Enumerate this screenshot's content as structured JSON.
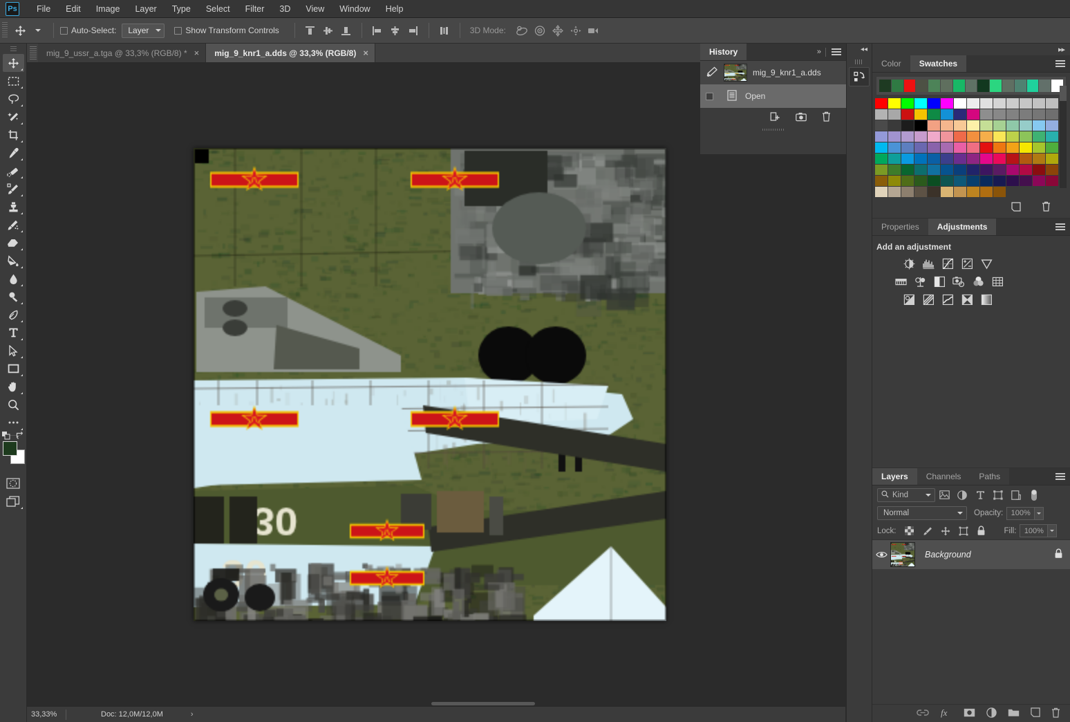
{
  "app": {
    "name": "Adobe Photoshop",
    "logo_text": "Ps"
  },
  "menubar": {
    "items": [
      {
        "label": "File"
      },
      {
        "label": "Edit"
      },
      {
        "label": "Image"
      },
      {
        "label": "Layer"
      },
      {
        "label": "Type"
      },
      {
        "label": "Select"
      },
      {
        "label": "Filter"
      },
      {
        "label": "3D"
      },
      {
        "label": "View"
      },
      {
        "label": "Window"
      },
      {
        "label": "Help"
      }
    ]
  },
  "options_bar": {
    "tool_icon": "move-tool-icon",
    "auto_select_label": "Auto-Select:",
    "auto_select_checked": false,
    "layer_dropdown_value": "Layer",
    "show_transform_label": "Show Transform Controls",
    "show_transform_checked": false,
    "align_icons": [
      "align-top-edges-icon",
      "align-vertical-centers-icon",
      "align-bottom-edges-icon",
      "align-left-edges-icon",
      "align-horizontal-centers-icon",
      "align-right-edges-icon",
      "distribute-icon"
    ],
    "mode_3d_label": "3D Mode:",
    "mode_3d_icons": [
      "orbit-3d-icon",
      "roll-3d-icon",
      "pan-3d-icon",
      "slide-3d-icon",
      "zoom-3d-camera-icon"
    ]
  },
  "toolbar": {
    "tools": [
      {
        "name": "move-tool",
        "icon": "move-tool-icon",
        "active": true
      },
      {
        "name": "rectangular-marquee-tool",
        "icon": "marquee-icon",
        "active": false
      },
      {
        "name": "lasso-tool",
        "icon": "lasso-icon",
        "active": false
      },
      {
        "name": "magic-wand-tool",
        "icon": "magic-wand-icon",
        "active": false
      },
      {
        "name": "crop-tool",
        "icon": "crop-icon",
        "active": false
      },
      {
        "name": "eyedropper-tool",
        "icon": "eyedropper-icon",
        "active": false
      },
      {
        "name": "spot-healing-brush-tool",
        "icon": "healing-brush-icon",
        "active": false
      },
      {
        "name": "brush-tool",
        "icon": "brush-icon",
        "active": false
      },
      {
        "name": "clone-stamp-tool",
        "icon": "clone-stamp-icon",
        "active": false
      },
      {
        "name": "history-brush-tool",
        "icon": "history-brush-icon",
        "active": false
      },
      {
        "name": "eraser-tool",
        "icon": "eraser-icon",
        "active": false
      },
      {
        "name": "gradient-tool",
        "icon": "paint-bucket-icon",
        "active": false
      },
      {
        "name": "blur-tool",
        "icon": "blur-drop-icon",
        "active": false
      },
      {
        "name": "dodge-tool",
        "icon": "dodge-icon",
        "active": false
      },
      {
        "name": "pen-tool",
        "icon": "pen-icon",
        "active": false
      },
      {
        "name": "type-tool",
        "icon": "type-icon",
        "active": false
      },
      {
        "name": "path-selection-tool",
        "icon": "path-selection-arrow-icon",
        "active": false
      },
      {
        "name": "rectangle-tool",
        "icon": "rectangle-shape-icon",
        "active": false
      },
      {
        "name": "hand-tool",
        "icon": "hand-icon",
        "active": false
      },
      {
        "name": "zoom-tool",
        "icon": "zoom-magnifier-icon",
        "active": false
      },
      {
        "name": "edit-toolbar",
        "icon": "ellipsis-icon",
        "active": false
      }
    ],
    "foreground_color": "#1d3a1d",
    "background_color": "#ffffff",
    "quick_mask_icon": "quick-mask-icon",
    "screen_mode_icon": "screen-mode-icon"
  },
  "document_tabs": [
    {
      "label": "mig_9_ussr_a.tga @ 33,3% (RGB/8) *",
      "active": false,
      "close": "×"
    },
    {
      "label": "mig_9_knr1_a.dds @ 33,3% (RGB/8)",
      "active": true,
      "close": "×"
    }
  ],
  "canvas": {
    "document_name": "mig_9_knr1_a.dds",
    "zoom": "33,3%",
    "markings_text": "30",
    "insignia": "chinese-red-star-roundel"
  },
  "status_bar": {
    "zoom": "33,33%",
    "doc_info": "Doc: 12,0M/12,0M",
    "expand_arrow": "›"
  },
  "collapsed_dock": {
    "collapse_icon": "◂◂",
    "button_icon": "history-panel-icon"
  },
  "history_panel": {
    "tab_label": "History",
    "expand_icon": "»",
    "menu_icon": "panel-menu-icon",
    "snapshot": {
      "label": "mig_9_knr1_a.dds",
      "icon": "history-source-icon"
    },
    "states": [
      {
        "label": "Open",
        "icon": "open-document-icon",
        "selected": true
      }
    ],
    "footer_buttons": [
      {
        "name": "create-document-from-state-button",
        "icon": "new-doc-icon"
      },
      {
        "name": "create-new-snapshot-button",
        "icon": "camera-icon"
      },
      {
        "name": "delete-state-button",
        "icon": "trash-icon"
      }
    ]
  },
  "color_swatches_panel": {
    "tabs": [
      {
        "label": "Color",
        "active": false
      },
      {
        "label": "Swatches",
        "active": true
      }
    ],
    "menu_icon": "panel-menu-icon",
    "recent_colors": [
      "#1e3a22",
      "#2f7a43",
      "#ee1111",
      "#4d5144",
      "#4d8358",
      "#5f6f5e",
      "#18b866",
      "#5f7265",
      "#12381f",
      "#2bd680",
      "#5f6f62",
      "#4f8271",
      "#1fd19c",
      "#62706a",
      "#ffffff"
    ],
    "grid_colors": [
      "#ff0000",
      "#ffff00",
      "#00ff00",
      "#00ffff",
      "#0000ff",
      "#ff00ff",
      "#ffffff",
      "#ededed",
      "#e0e0e0",
      "#d4d4d4",
      "#cccccc",
      "#c6c6c6",
      "#c2c2c2",
      "#bfbfbf",
      "#b3b3b3",
      "#a8a8a8",
      "#cc1111",
      "#f5c400",
      "#0f8a45",
      "#1391d6",
      "#2a2a78",
      "#d4077f",
      "#8e8e8e",
      "#888888",
      "#828282",
      "#7c7c7c",
      "#767676",
      "#6f6f6f",
      "#4a4a4a",
      "#3a3a3a",
      "#1c1c1c",
      "#000000",
      "#f2a183",
      "#f4b68d",
      "#f7c996",
      "#fdf0a8",
      "#c5de96",
      "#a6d193",
      "#8fc8a8",
      "#96ccc9",
      "#86c9f0",
      "#93aee0",
      "#9399d8",
      "#a193cf",
      "#b29bd0",
      "#c79ccd",
      "#efa9c9",
      "#f0959c",
      "#ef6a4a",
      "#f2903f",
      "#f5ae4a",
      "#fae657",
      "#bdd14a",
      "#8cc45a",
      "#3fb273",
      "#29b0ad",
      "#00b9f0",
      "#4a93d6",
      "#5d7fc0",
      "#6a68b0",
      "#8a63ab",
      "#a86bb0",
      "#e95fa5",
      "#ef6e83",
      "#e31010",
      "#ee7711",
      "#f3a317",
      "#f5e600",
      "#a6c62c",
      "#4fae3c",
      "#00a85c",
      "#0e9e9a",
      "#0a9ae0",
      "#0072bb",
      "#0b5fa5",
      "#3b3f8c",
      "#6a2e8f",
      "#8e2583",
      "#e4088b",
      "#ea0a5a",
      "#b81317",
      "#b25a10",
      "#b07a12",
      "#b0a90c",
      "#7b9a24",
      "#3e7c2a",
      "#09662f",
      "#0d6e6d",
      "#1070a1",
      "#07538f",
      "#0a3f7b",
      "#20246a",
      "#3d1560",
      "#5a1b63",
      "#a8086d",
      "#b20a44",
      "#8a0d0f",
      "#8c4409",
      "#8a5d09",
      "#8d8a08",
      "#4f6d18",
      "#2b5a1c",
      "#0b4e22",
      "#0d5552",
      "#0d5878",
      "#073f6e",
      "#0a2a5c",
      "#181a52",
      "#2d0f4c",
      "#440f4d",
      "#8c0758",
      "#8a0738",
      "#e0d3ba",
      "#b4a693",
      "#8d7f6e",
      "#5d5245",
      "#3b3229",
      "#d9b472",
      "#c29450",
      "#bd8420",
      "#b06e11",
      "#8a5409"
    ],
    "footer_buttons": [
      {
        "name": "new-swatch-button",
        "icon": "new-swatch-icon"
      },
      {
        "name": "delete-swatch-button",
        "icon": "trash-icon"
      }
    ]
  },
  "adjustments_panel": {
    "tabs": [
      {
        "label": "Properties",
        "active": false
      },
      {
        "label": "Adjustments",
        "active": true
      }
    ],
    "menu_icon": "panel-menu-icon",
    "heading": "Add an adjustment",
    "rows": [
      [
        "brightness-contrast-icon",
        "levels-icon",
        "curves-icon",
        "exposure-icon",
        "vibrance-icon"
      ],
      [
        "hue-saturation-icon",
        "color-balance-icon",
        "black-white-icon",
        "photo-filter-icon",
        "channel-mixer-icon",
        "color-lookup-icon"
      ],
      [
        "invert-icon",
        "posterize-icon",
        "threshold-icon",
        "selective-color-icon",
        "gradient-map-icon"
      ]
    ]
  },
  "layers_panel": {
    "tabs": [
      {
        "label": "Layers",
        "active": true
      },
      {
        "label": "Channels",
        "active": false
      },
      {
        "label": "Paths",
        "active": false
      }
    ],
    "menu_icon": "panel-menu-icon",
    "filter": {
      "kind_label": "Kind",
      "search_icon": "search-icon",
      "filter_icons": [
        "filter-pixel-icon",
        "filter-adjustment-icon",
        "filter-type-icon",
        "filter-shape-icon",
        "filter-smart-object-icon"
      ],
      "toggle_icon": "filter-toggle-switch"
    },
    "blend_mode": "Normal",
    "opacity_label": "Opacity:",
    "opacity_value": "100%",
    "lock_label": "Lock:",
    "lock_icons": [
      "lock-transparency-icon",
      "lock-image-pixels-icon",
      "lock-position-icon",
      "lock-artboard-icon",
      "lock-all-icon"
    ],
    "fill_label": "Fill:",
    "fill_value": "100%",
    "layers": [
      {
        "name": "Background",
        "visible": true,
        "locked": true,
        "thumbnail": "aircraft-texture-thumb"
      }
    ],
    "footer_buttons": [
      {
        "name": "link-layers-button",
        "icon": "link-icon"
      },
      {
        "name": "layer-style-button",
        "icon": "fx-icon"
      },
      {
        "name": "add-layer-mask-button",
        "icon": "layer-mask-icon"
      },
      {
        "name": "new-fill-adjustment-button",
        "icon": "adjustment-circle-icon"
      },
      {
        "name": "new-group-button",
        "icon": "folder-icon"
      },
      {
        "name": "new-layer-button",
        "icon": "new-layer-icon"
      },
      {
        "name": "delete-layer-button",
        "icon": "trash-icon"
      }
    ]
  }
}
